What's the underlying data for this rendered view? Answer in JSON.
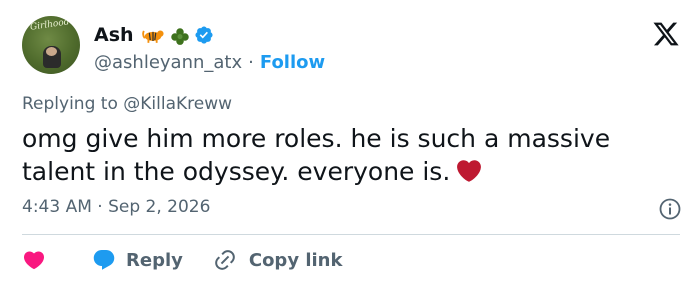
{
  "author": {
    "display_name": "Ash",
    "handle": "@ashleyann_atx",
    "separator": "·",
    "follow_label": "Follow",
    "emojis": [
      "tiger-emoji",
      "shamrock-emoji"
    ],
    "verified": true,
    "avatar_text": "Girlhood"
  },
  "reply_context": {
    "prefix": "Replying to",
    "mention": "@KillaKreww"
  },
  "tweet": {
    "text": "omg give him more roles. he is such a massive talent in the odyssey. everyone is.",
    "emoji": "red-heart"
  },
  "meta": {
    "time": "4:43 AM",
    "separator": "·",
    "date": "Sep 2, 2026"
  },
  "actions": {
    "like_label": "",
    "reply_label": "Reply",
    "copy_label": "Copy link"
  },
  "colors": {
    "accent": "#1d9bf0",
    "text": "#0f1419",
    "secondary": "#536471",
    "like": "#f91880",
    "heart_emoji": "#be1931",
    "divider": "#cfd9de"
  },
  "icons": {
    "brand": "x-logo-icon",
    "info": "info-icon",
    "like": "heart-icon",
    "reply": "speech-bubble-icon",
    "copy": "link-icon"
  }
}
